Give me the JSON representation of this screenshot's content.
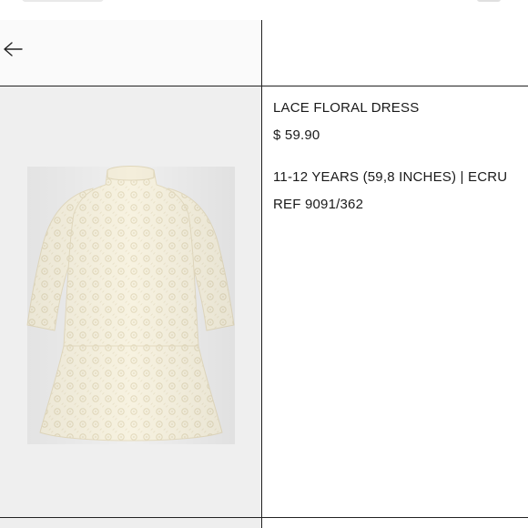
{
  "product": {
    "name": "LACE FLORAL DRESS",
    "price": "$ 59.90",
    "variant": "11-12 YEARS (59,8 INCHES) | ECRU",
    "ref": "REF 9091/362"
  },
  "icons": {
    "back": "arrow-left-icon"
  },
  "colors": {
    "background": "#ffffff",
    "image_background": "#efefef",
    "dress": "#f6f1de",
    "text": "#1a1a1a",
    "divider": "#222222"
  }
}
